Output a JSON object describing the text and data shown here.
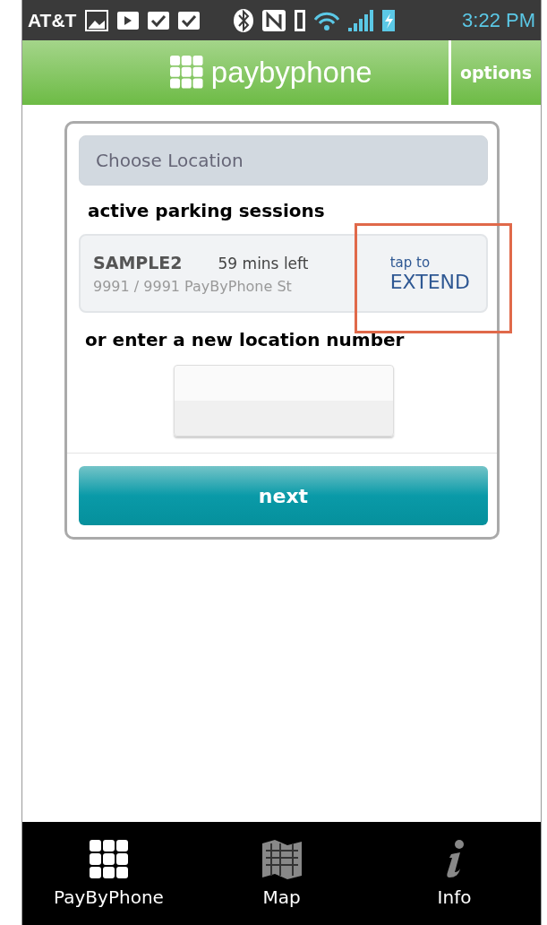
{
  "status_bar": {
    "carrier": "AT&T",
    "time": "3:22 PM"
  },
  "header": {
    "logo": "paybyphone",
    "options": "options"
  },
  "location_field": {
    "placeholder": "Choose Location"
  },
  "sessions_heading": "active parking sessions",
  "sessions": [
    {
      "name": "SAMPLE2",
      "time_left": "59 mins left",
      "address": "9991 / 9991 PayByPhone St",
      "action_hint": "tap to",
      "action": "EXTEND",
      "highlighted": true
    }
  ],
  "new_location_heading": "or enter a new location number",
  "location_number": {
    "kind": "input"
  },
  "next_button": "next",
  "bottom_nav": [
    {
      "label": "PayByPhone",
      "kind": "keypad",
      "selected": true
    },
    {
      "label": "Map",
      "kind": "map",
      "selected": false
    },
    {
      "label": "Info",
      "kind": "info",
      "selected": false
    }
  ]
}
